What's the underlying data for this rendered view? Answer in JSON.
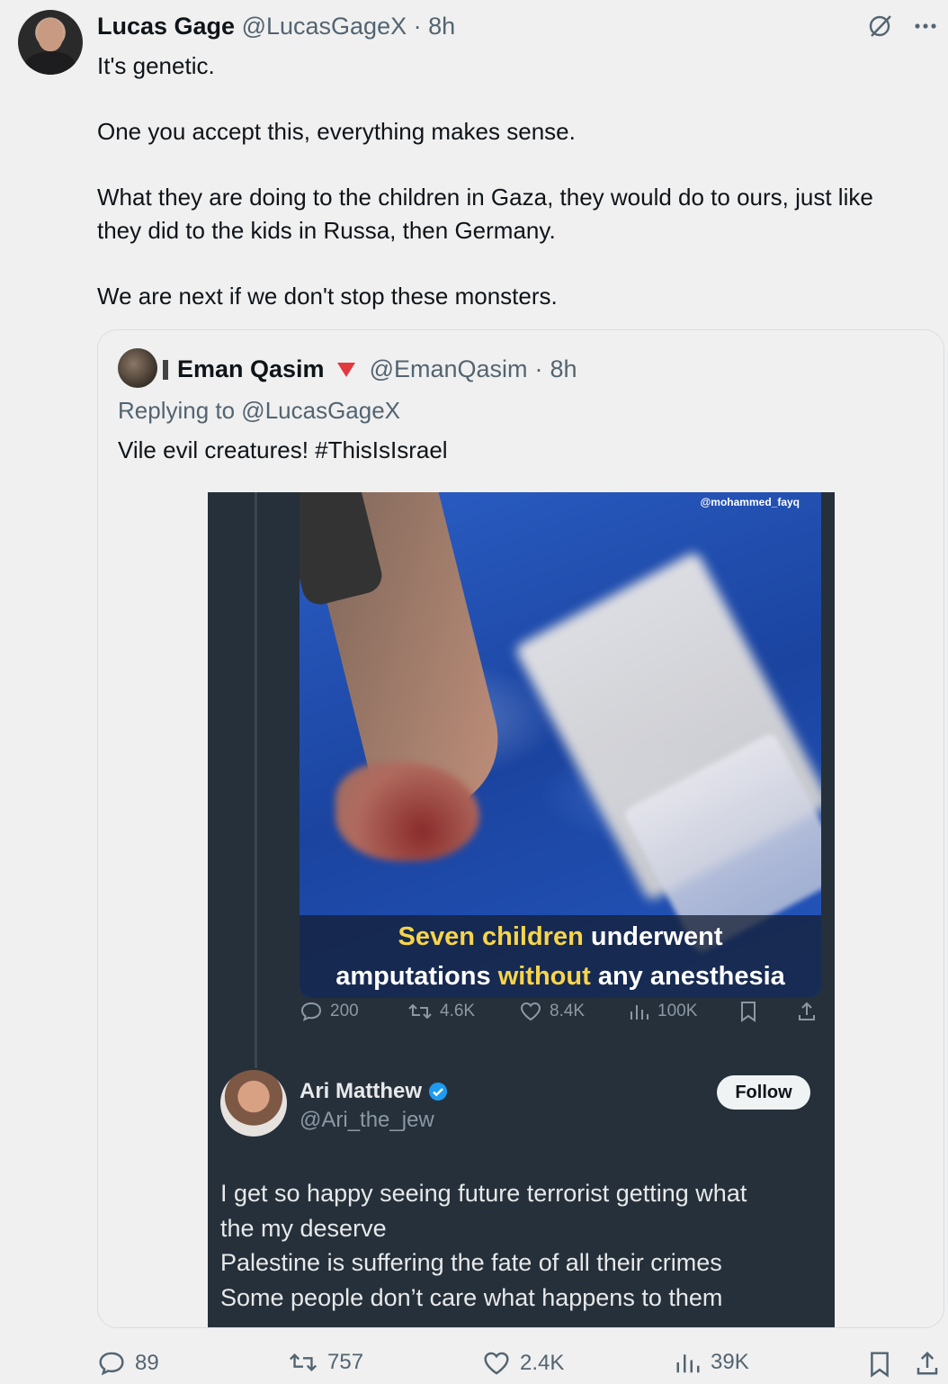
{
  "post": {
    "display_name": "Lucas Gage",
    "handle": "@LucasGageX",
    "separator": "·",
    "time": "8h",
    "lines": [
      "It's genetic.",
      "",
      "One you accept this, everything makes sense.",
      "",
      "What they are doing to the children in Gaza, they would do to ours, just like",
      "they did to the kids in Russa, then Germany.",
      "",
      "We are next if we don't stop these monsters."
    ],
    "icons": [
      "grok-icon",
      "more-icon"
    ],
    "stats": {
      "replies": "89",
      "reposts": "757",
      "likes": "2.4K",
      "views": "39K"
    }
  },
  "quote": {
    "display_name": "Eman Qasim",
    "handle": "@EmanQasim",
    "separator": "·",
    "time": "8h",
    "replying_to": "Replying to @LucasGageX",
    "text": "Vile evil creatures! #ThisIsIsrael",
    "embedded_screenshot": {
      "watermark": "@mohammed_fayq",
      "caption_line1_highlight": "Seven children",
      "caption_line1_rest": " underwent",
      "caption_line2_a": "amputations ",
      "caption_line2_highlight": "without",
      "caption_line2_b": " any anesthesia",
      "stats": {
        "replies": "200",
        "reposts": "4.6K",
        "likes": "8.4K",
        "views": "100K"
      },
      "reply": {
        "display_name": "Ari Matthew",
        "handle": "@Ari_the_jew",
        "follow_label": "Follow",
        "lines": [
          "I get so happy seeing future terrorist getting what",
          "the my deserve",
          "Palestine is suffering the fate of all their crimes",
          "Some people don’t care what happens to them"
        ]
      }
    }
  },
  "colors": {
    "background": "#f0f0f0",
    "text": "#0f1419",
    "muted": "#536471",
    "embed_bg": "#26303a",
    "caption_highlight": "#f7d54a",
    "verified": "#1d9bf0"
  }
}
